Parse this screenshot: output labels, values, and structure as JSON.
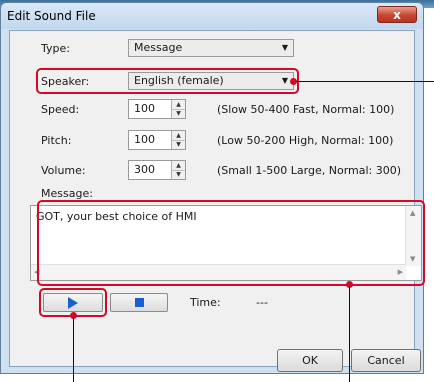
{
  "window": {
    "title": "Edit Sound File",
    "close_glyph": "x"
  },
  "form": {
    "type_label": "Type:",
    "type_value": "Message",
    "speaker_label": "Speaker:",
    "speaker_value": "English (female)",
    "speed_label": "Speed:",
    "speed_value": "100",
    "speed_hint": "(Slow 50-400 Fast, Normal: 100)",
    "pitch_label": "Pitch:",
    "pitch_value": "100",
    "pitch_hint": "(Low 50-200 High, Normal: 100)",
    "volume_label": "Volume:",
    "volume_value": "300",
    "volume_hint": "(Small 1-500 Large, Normal: 300)",
    "message_label": "Message:",
    "message_value": "GOT, your best choice of HMI"
  },
  "playback": {
    "time_label": "Time:",
    "time_value": "---"
  },
  "footer": {
    "ok_label": "OK",
    "cancel_label": "Cancel"
  },
  "icons": {
    "dropdown_arrow": "chevron-down-icon",
    "play": "play-icon",
    "stop": "stop-icon",
    "spin_up": "spin-up-icon",
    "spin_down": "spin-down-icon"
  },
  "colors": {
    "annotation_red": "#d10a2a",
    "play_blue": "#1a5fd0",
    "title_bg": "#cfe0f1",
    "close_red": "#c9452f"
  }
}
